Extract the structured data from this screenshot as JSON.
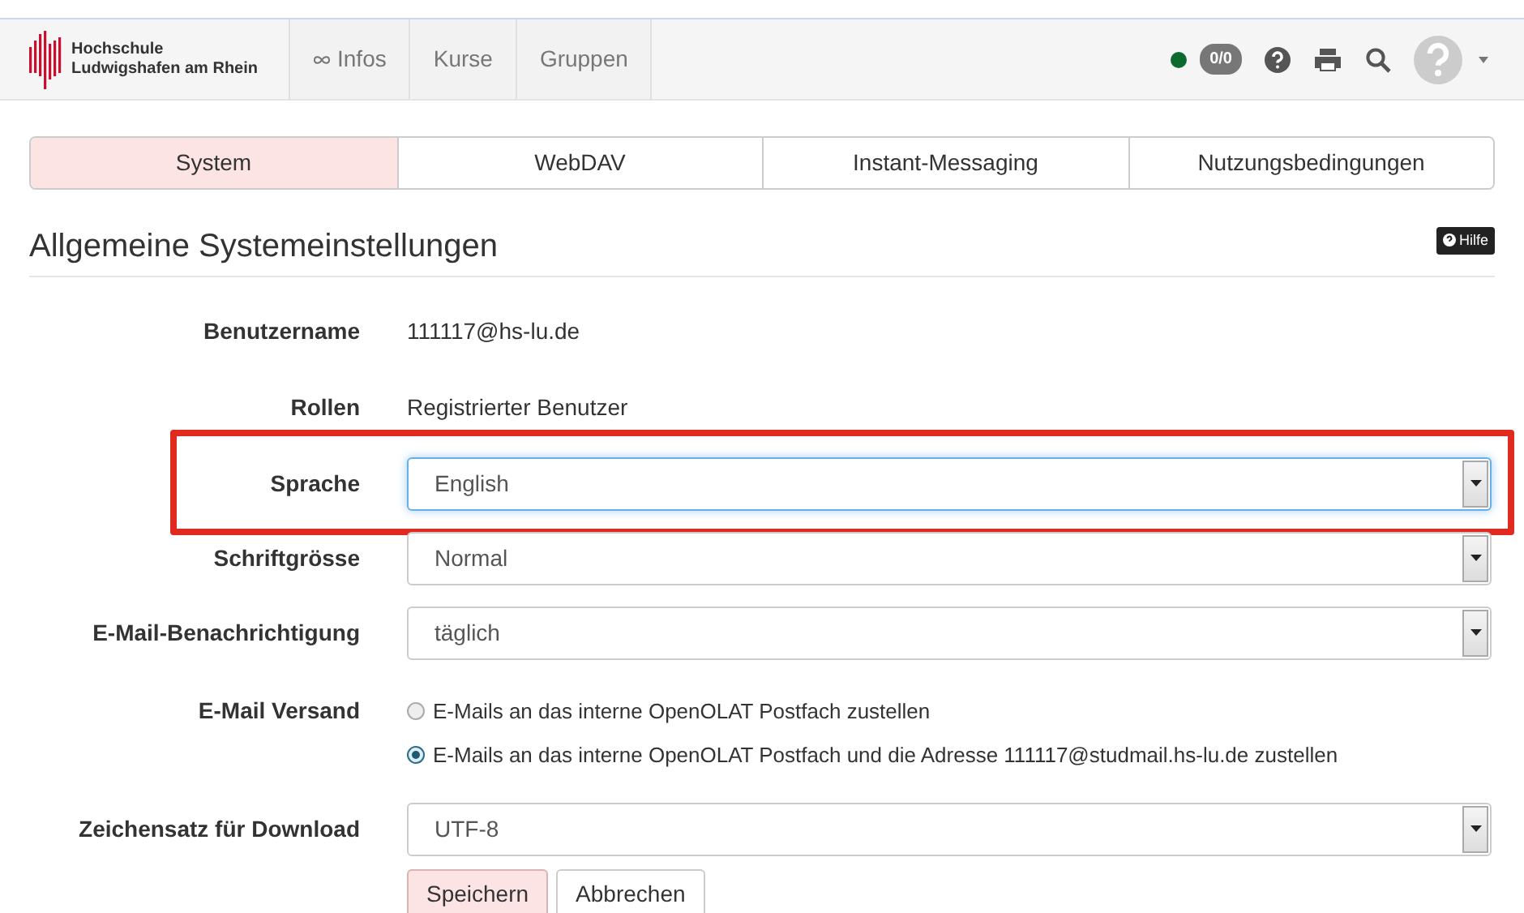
{
  "navbar": {
    "brand": [
      "Hochschule",
      "Ludwigshafen am Rhein"
    ],
    "items": [
      {
        "kind": "info",
        "label": "Infos",
        "selected": false
      },
      {
        "kind": "link",
        "label": "Kurse",
        "selected": false
      },
      {
        "kind": "link",
        "label": "Gruppen",
        "selected": false
      }
    ],
    "status": {
      "color": "#0b6b2f"
    },
    "chat_badge": "0/0"
  },
  "tabs": [
    {
      "label": "System",
      "selected": true
    },
    {
      "label": "WebDAV",
      "selected": false
    },
    {
      "label": "Instant-Messaging",
      "selected": false
    },
    {
      "label": "Nutzungsbedingungen",
      "selected": false
    }
  ],
  "section": {
    "title": "Allgemeine Systemeinstellungen",
    "help_button": "Hilfe"
  },
  "form": [
    {
      "kind": "text",
      "label": "Benutzername",
      "value": "111117@hs-lu.de"
    },
    {
      "kind": "text",
      "label": "Rollen",
      "value": "Registrierter Benutzer"
    },
    {
      "kind": "select",
      "label": "Sprache",
      "value": "English",
      "focused": true,
      "highlighted": true
    },
    {
      "kind": "select",
      "label": "Schriftgrösse",
      "value": "Normal",
      "focused": false,
      "highlighted": false
    },
    {
      "kind": "select",
      "label": "E-Mail-Benachrichtigung",
      "value": "täglich",
      "focused": false,
      "highlighted": false
    },
    {
      "kind": "radio",
      "label": "E-Mail Versand",
      "options": [
        {
          "label": "E-Mails an das interne OpenOLAT Postfach zustellen",
          "selected": false
        },
        {
          "label": "E-Mails an das interne OpenOLAT Postfach und die Adresse 111117@studmail.hs-lu.de zustellen",
          "selected": true
        }
      ]
    },
    {
      "kind": "select",
      "label": "Zeichensatz für Download",
      "value": "UTF-8",
      "focused": false,
      "highlighted": false
    }
  ],
  "buttons": [
    {
      "label": "Speichern",
      "primary": true
    },
    {
      "label": "Abbrechen",
      "primary": false
    }
  ]
}
